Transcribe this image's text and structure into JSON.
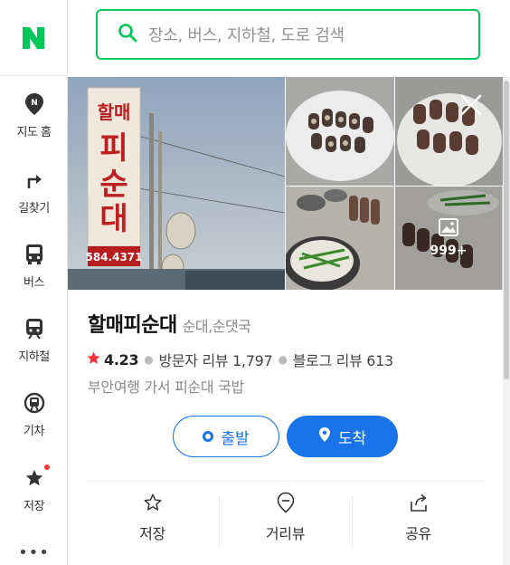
{
  "brand": {
    "logo_letter": "N",
    "accent": "#03c75a"
  },
  "sidebar": {
    "items": [
      {
        "label": "지도 홈",
        "icon": "map-pin-n-icon"
      },
      {
        "label": "길찾기",
        "icon": "directions-arrow-icon"
      },
      {
        "label": "버스",
        "icon": "bus-icon"
      },
      {
        "label": "지하철",
        "icon": "subway-icon"
      },
      {
        "label": "기차",
        "icon": "train-icon"
      },
      {
        "label": "저장",
        "icon": "star-icon"
      }
    ],
    "more": "•••"
  },
  "search": {
    "placeholder": "장소, 버스, 지하철, 도로 검색"
  },
  "place": {
    "name": "할매피순대",
    "category": "순대,순댓국",
    "rating": "4.23",
    "visitor_reviews": "방문자 리뷰 1,797",
    "blog_reviews": "블로그 리뷰 613",
    "description": "부안여행 가서 피순대 국밥",
    "photo_count": "999+",
    "sign_texts": {
      "top": "할매",
      "mid1": "피",
      "mid2": "순",
      "bottom": "대",
      "phone": "584.4371"
    },
    "buttons": {
      "depart": "출발",
      "arrive": "도착"
    },
    "actions": [
      {
        "label": "저장",
        "icon": "star-outline-icon"
      },
      {
        "label": "거리뷰",
        "icon": "street-view-icon"
      },
      {
        "label": "공유",
        "icon": "share-icon"
      }
    ]
  },
  "colors": {
    "primary_blue": "#1a73e8",
    "star_red": "#f4333a"
  }
}
